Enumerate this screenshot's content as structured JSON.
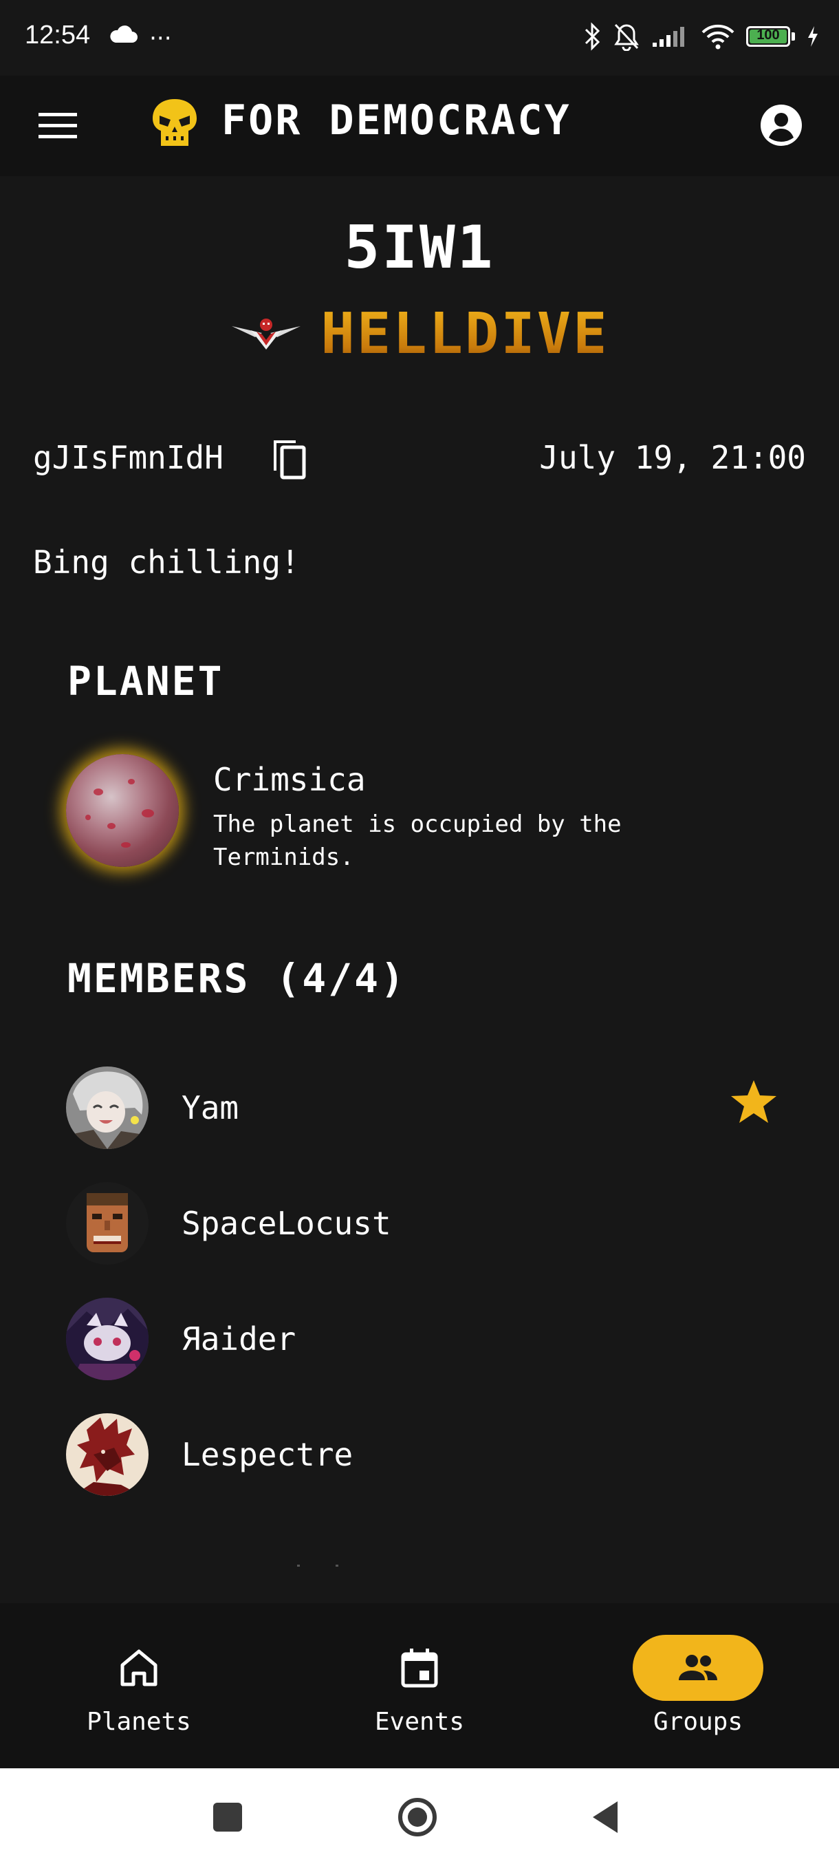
{
  "status_bar": {
    "time": "12:54",
    "overflow": "···",
    "battery": "100"
  },
  "app_bar": {
    "title": "FOR DEMOCRACY"
  },
  "group": {
    "code": "5IW1",
    "mission_type": "HELLDIVE",
    "id": "gJIsFmnIdH",
    "datetime": "July 19, 21:00",
    "description": "Bing chilling!"
  },
  "planet_section": {
    "title": "PLANET",
    "name": "Crimsica",
    "description": "The planet is occupied by the Terminids."
  },
  "members_section": {
    "title": "MEMBERS (4/4)",
    "members": [
      {
        "name": "Yam",
        "leader": true
      },
      {
        "name": "SpaceLocust",
        "leader": false
      },
      {
        "name": "Яaider",
        "leader": false
      },
      {
        "name": "Lespectre",
        "leader": false
      }
    ]
  },
  "bottom_nav": {
    "items": [
      {
        "label": "Planets",
        "icon": "home-icon",
        "active": false
      },
      {
        "label": "Events",
        "icon": "calendar-icon",
        "active": false
      },
      {
        "label": "Groups",
        "icon": "group-icon",
        "active": true
      }
    ]
  },
  "colors": {
    "background": "#171717",
    "app_bar": "#121212",
    "accent": "#f2b51b",
    "mission_gold": "#d9920f"
  }
}
